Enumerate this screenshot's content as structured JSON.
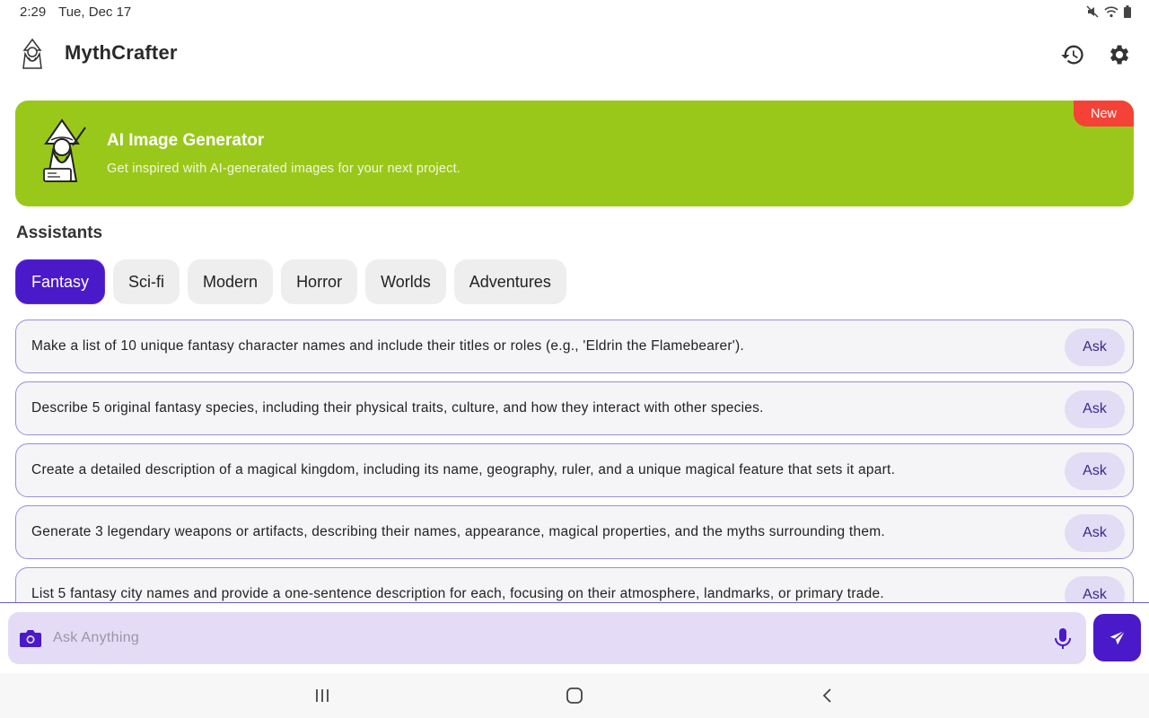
{
  "status_bar": {
    "time": "2:29",
    "date": "Tue, Dec 17"
  },
  "app_bar": {
    "title": "MythCrafter"
  },
  "banner": {
    "title": "AI Image Generator",
    "subtitle": "Get inspired with AI-generated images for your next project.",
    "badge": "New",
    "color": "#9ac81a",
    "badge_color": "#f44336"
  },
  "assistants": {
    "heading": "Assistants",
    "tabs": [
      {
        "label": "Fantasy",
        "active": true
      },
      {
        "label": "Sci-fi",
        "active": false
      },
      {
        "label": "Modern",
        "active": false
      },
      {
        "label": "Horror",
        "active": false
      },
      {
        "label": "Worlds",
        "active": false
      },
      {
        "label": "Adventures",
        "active": false
      }
    ],
    "accent_color": "#4a19c9"
  },
  "prompts": [
    {
      "text": "Make a list of 10 unique fantasy character names and include their titles or roles (e.g., 'Eldrin the Flamebearer').",
      "action": "Ask"
    },
    {
      "text": "Describe 5 original fantasy species, including their physical traits, culture, and how they interact with other species.",
      "action": "Ask"
    },
    {
      "text": "Create a detailed description of a magical kingdom, including its name, geography, ruler, and a unique magical feature that sets it apart.",
      "action": "Ask"
    },
    {
      "text": "Generate 3 legendary weapons or artifacts, describing their names, appearance, magical properties, and the myths surrounding them.",
      "action": "Ask"
    },
    {
      "text": "List 5 fantasy city names and provide a one-sentence description for each, focusing on their atmosphere, landmarks, or primary trade.",
      "action": "Ask"
    }
  ],
  "input": {
    "placeholder": "Ask Anything",
    "value": ""
  }
}
